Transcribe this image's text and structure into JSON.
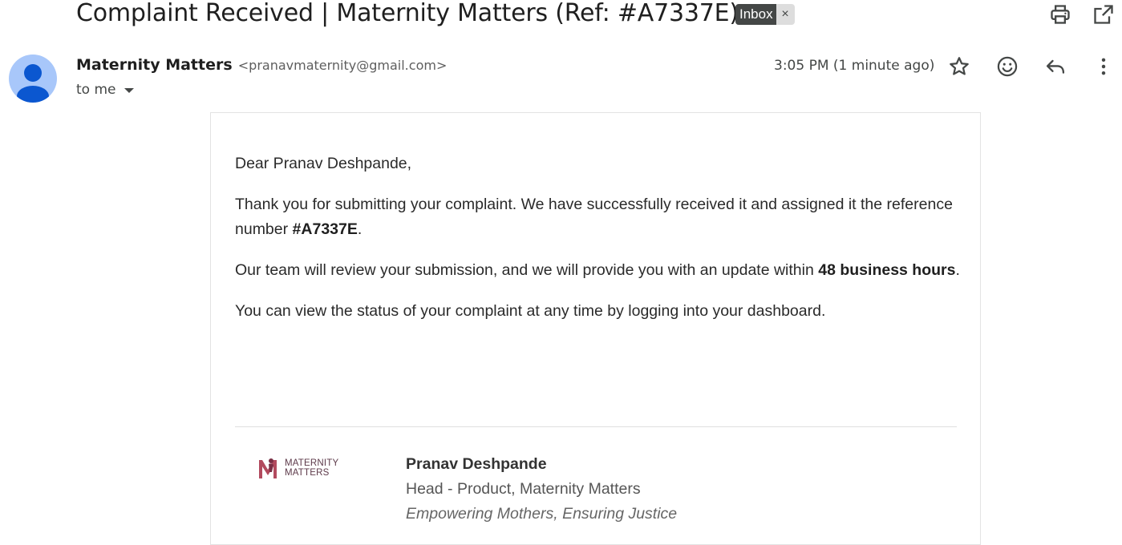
{
  "header": {
    "subject": "Complaint Received | Maternity Matters (Ref: #A7337E)",
    "label": "Inbox",
    "label_remove": "×",
    "icons": [
      "print-icon",
      "open-in-new-window-icon"
    ]
  },
  "message": {
    "sender_name": "Maternity Matters",
    "sender_email": "<pranavmaternity@gmail.com>",
    "recipient": "to me",
    "timestamp": "3:05 PM (1 minute ago)",
    "actions": [
      "star-icon",
      "emoji-reaction-icon",
      "reply-icon",
      "more-options-icon"
    ]
  },
  "body": {
    "greeting": "Dear Pranav Deshpande,",
    "p1_pre": "Thank you for submitting your complaint. We have successfully received it and assigned it the reference number ",
    "p1_bold": "#A7337E",
    "p1_post": ".",
    "p2_pre": "Our team will review your submission, and we will provide you with an update within ",
    "p2_bold": "48 business hours",
    "p2_post": ".",
    "p3": "You can view the status of your complaint at any time by logging into your dashboard."
  },
  "signature": {
    "logo_line1": "MATERNITY",
    "logo_line2": "MATTERS",
    "name": "Pranav Deshpande",
    "role": "Head - Product, Maternity Matters",
    "tagline": "Empowering Mothers, Ensuring Justice"
  },
  "colors": {
    "avatar_bg": "#a8c7fa",
    "avatar_fg": "#0b57d0",
    "label_bg": "#444746",
    "logo_accent": "#b24a5e"
  }
}
